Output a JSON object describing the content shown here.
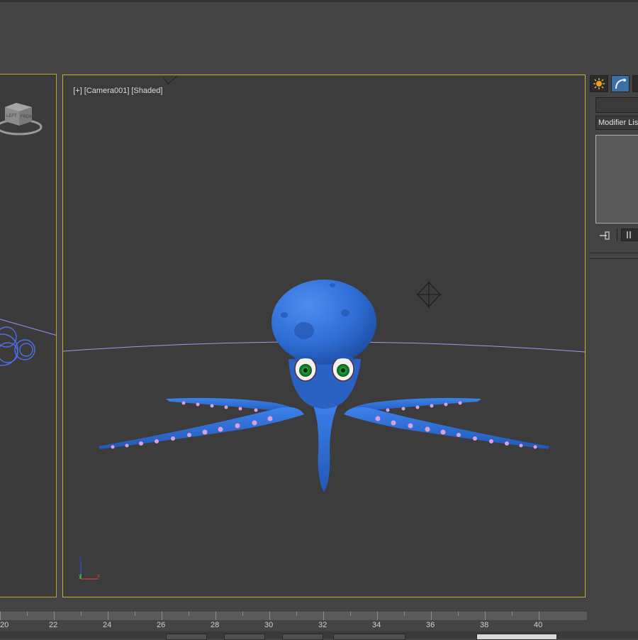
{
  "viewport_main": {
    "label_plus": "[+]",
    "label_camera": "[Camera001]",
    "label_mode": "[Shaded]"
  },
  "viewcube": {
    "left_face": "LEFT",
    "front_face": "FRONT"
  },
  "axis_gizmo": {
    "z": "z",
    "y": "y",
    "x": "x"
  },
  "command_panel": {
    "modifier_list_label": "Modifier List"
  },
  "timeline": {
    "frame_labels": [
      "20",
      "22",
      "24",
      "26",
      "28",
      "30",
      "32",
      "34",
      "36",
      "38",
      "40"
    ]
  },
  "colors": {
    "viewport_border_active": "#c8b22a",
    "octopus_body": "#2f6fd6",
    "suckers": "#d9a0e0",
    "eye_iris": "#1a8c2a",
    "camera_path": "#b38fe6"
  }
}
